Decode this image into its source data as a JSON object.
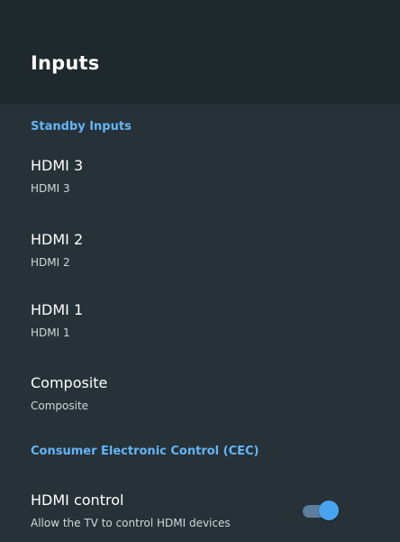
{
  "header": {
    "title": "Inputs"
  },
  "sections": {
    "standby": {
      "title": "Standby Inputs",
      "items": [
        {
          "title": "HDMI 3",
          "subtitle": "HDMI 3"
        },
        {
          "title": "HDMI 2",
          "subtitle": "HDMI 2"
        },
        {
          "title": "HDMI 1",
          "subtitle": "HDMI 1"
        },
        {
          "title": "Composite",
          "subtitle": "Composite"
        }
      ]
    },
    "cec": {
      "title": "Consumer Electronic Control (CEC)",
      "items": [
        {
          "title": "HDMI control",
          "subtitle": "Allow the TV to control HDMI devices",
          "toggle_on": true
        }
      ]
    }
  },
  "colors": {
    "background": "#263238",
    "header_background": "#1e282d",
    "accent": "#64b5f6"
  }
}
